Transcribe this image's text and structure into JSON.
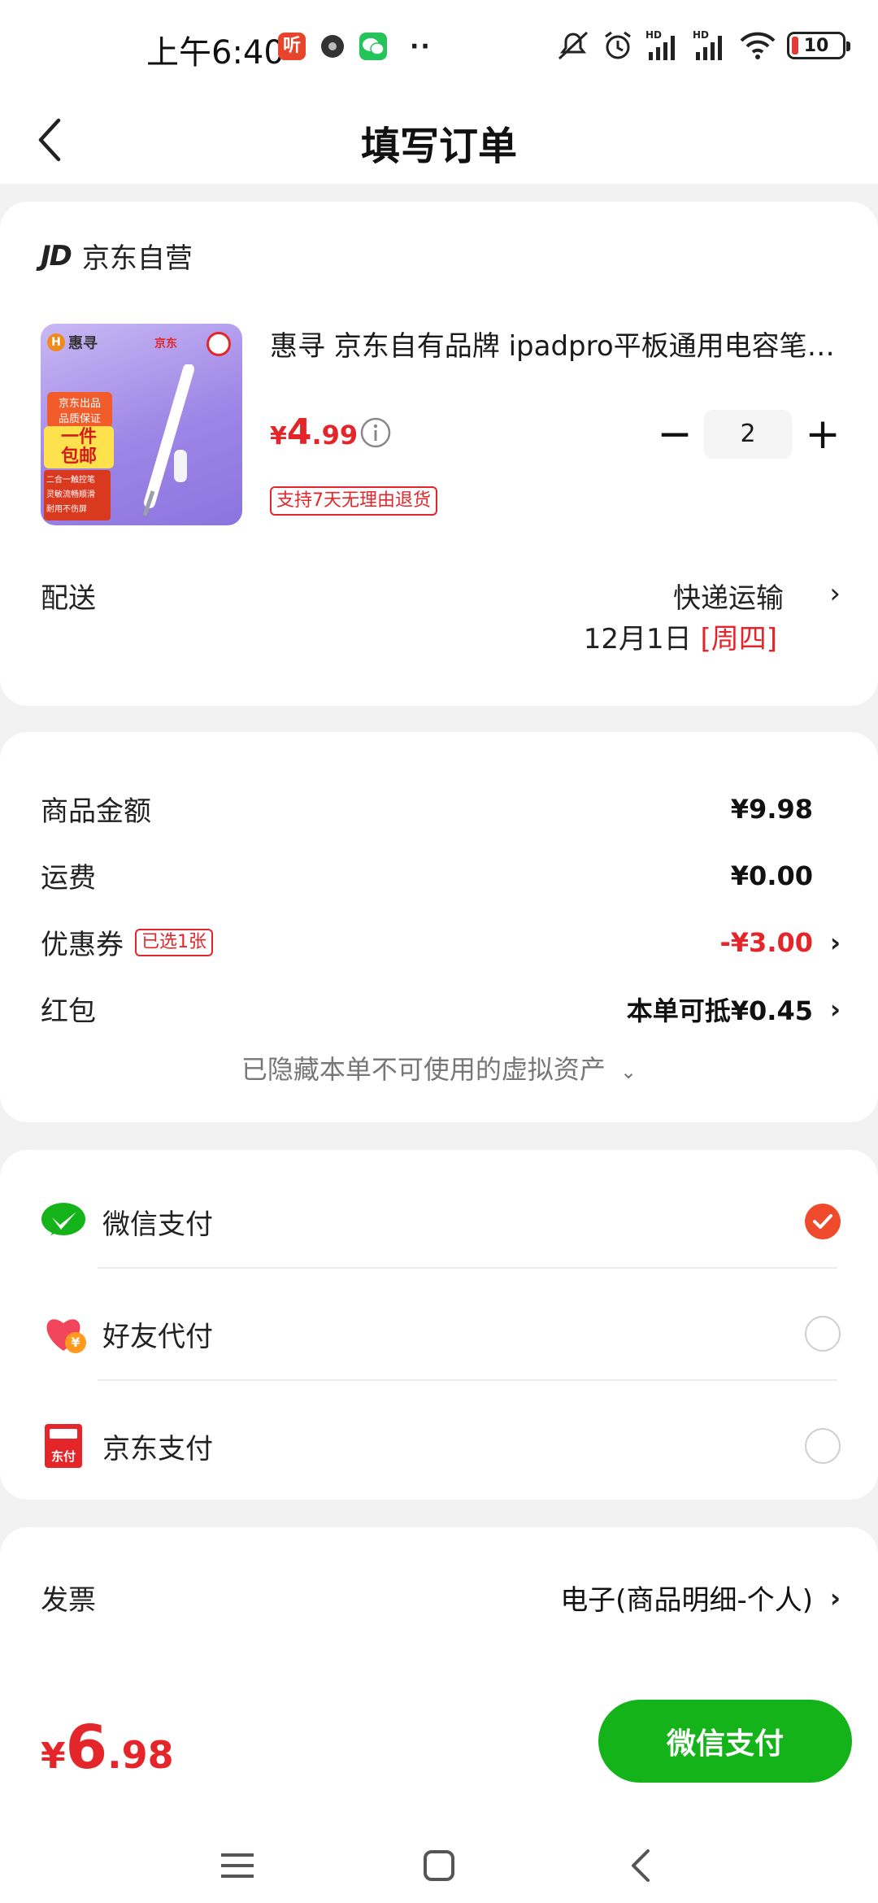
{
  "status_bar": {
    "time": "上午6:40",
    "battery": "10",
    "app_icon_1_text": "听"
  },
  "header": {
    "title": "填写订单"
  },
  "shop": {
    "logo": "JD",
    "name": "京东自营"
  },
  "product": {
    "title": "惠寻 京东自有品牌 ipadpro平板通用电容笔 手写触控笔",
    "price_symbol": "¥",
    "price_int": "4",
    "price_dec": ".99",
    "quantity": "2",
    "return_tag": "支持7天无理由退货",
    "image_texts": {
      "brand": "惠寻",
      "jd": "京东",
      "badge_top": "京东出品",
      "badge_mid": "品质保证",
      "badge_big1": "一件",
      "badge_big2": "包邮",
      "feature_1": "二合一触控笔",
      "feature_2": "灵敏流畅顺滑",
      "feature_3": "耐用不伤屏"
    }
  },
  "delivery": {
    "label": "配送",
    "method": "快递运输",
    "date": "12月1日",
    "weekday": "[周四]"
  },
  "summary": {
    "goods_label": "商品金额",
    "goods_value": "¥9.98",
    "shipping_label": "运费",
    "shipping_value": "¥0.00",
    "coupon_label": "优惠券",
    "coupon_tag": "已选1张",
    "coupon_value": "-¥3.00",
    "redpacket_label": "红包",
    "redpacket_value": "本单可抵¥0.45",
    "hidden_assets": "已隐藏本单不可使用的虚拟资产"
  },
  "payment": {
    "methods": [
      {
        "label": "微信支付",
        "selected": true
      },
      {
        "label": "好友代付",
        "selected": false
      },
      {
        "label": "京东支付",
        "selected": false
      }
    ],
    "jd_pay_icon_text": "东付",
    "friend_pay_icon_text": "¥"
  },
  "invoice": {
    "label": "发票",
    "value": "电子(商品明细-个人)"
  },
  "footer": {
    "total_symbol": "¥",
    "total_int": "6",
    "total_dec": ".98",
    "pay_button": "微信支付"
  },
  "colors": {
    "accent_red": "#e4262a",
    "wechat_green": "#15b31a",
    "radio_selected": "#f04a2c"
  }
}
